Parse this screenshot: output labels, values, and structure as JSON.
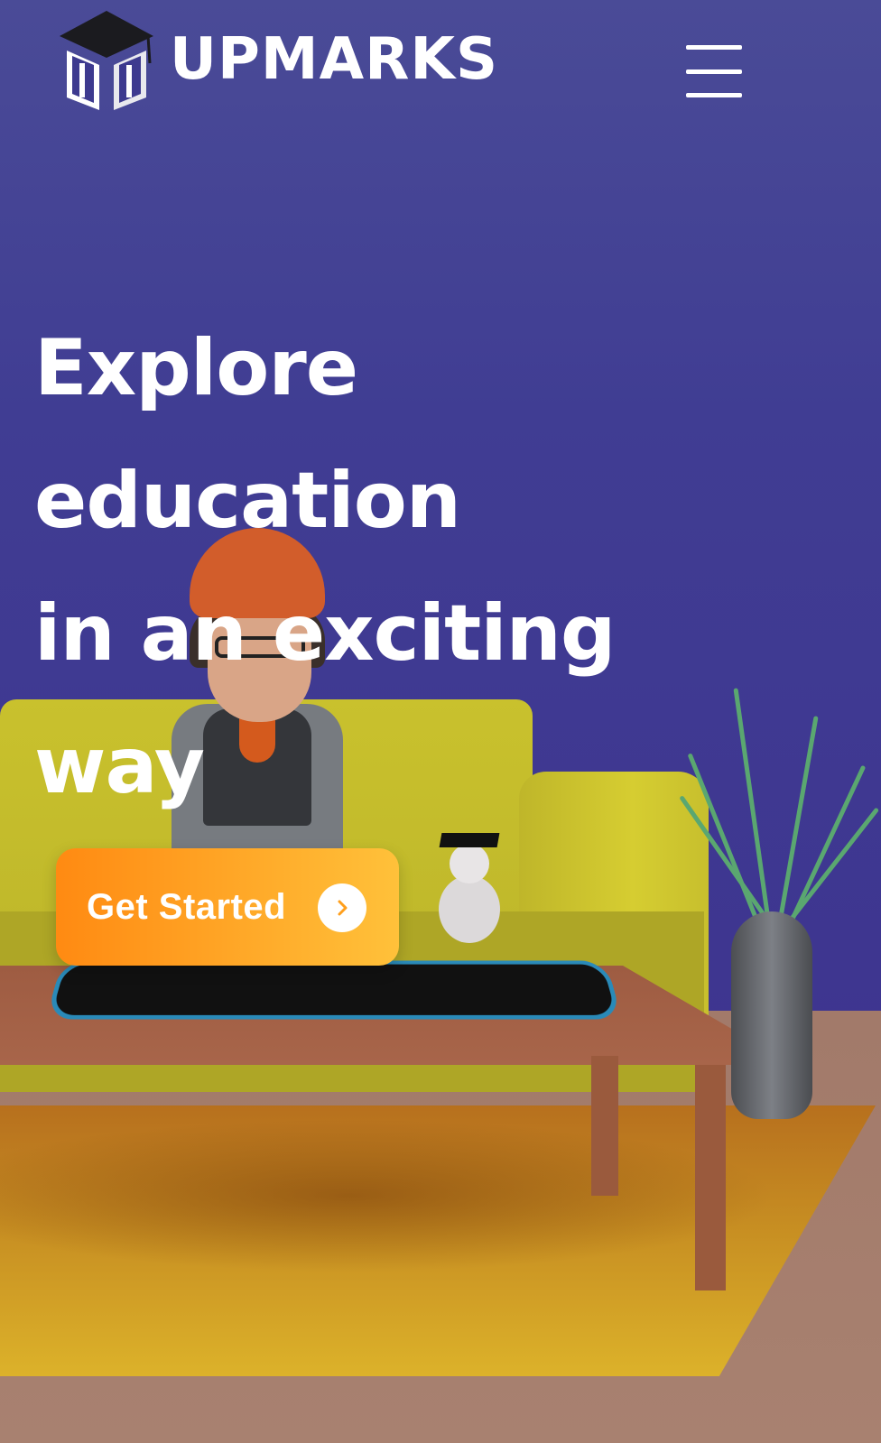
{
  "header": {
    "logo_text": "UPMARKS",
    "logo_icon": "graduation-cube-logo-icon",
    "menu_icon": "hamburger-menu-icon"
  },
  "hero": {
    "title_lines": [
      "Explore",
      "education",
      "in an exciting",
      "way"
    ],
    "cta_label": "Get Started",
    "cta_icon": "chevron-right-circle-icon"
  },
  "colors": {
    "background": "#403d93",
    "cta_gradient_start": "#ff8a12",
    "cta_gradient_end": "#ffc13a",
    "text": "#ffffff"
  }
}
